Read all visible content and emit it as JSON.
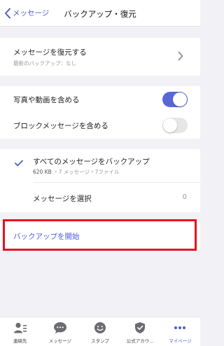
{
  "header": {
    "back_label": "メッセージ",
    "title": "バックアップ・復元"
  },
  "restore": {
    "title": "メッセージを復元する",
    "subtitle": "最新のバックアップ：なし"
  },
  "toggles": [
    {
      "label": "写真や動画を含める",
      "on": true
    },
    {
      "label": "ブロックメッセージを含める",
      "on": false
    }
  ],
  "backup_options": {
    "all": {
      "title": "すべてのメッセージをバックアップ",
      "size": "620 KB",
      "detail": "・7 メッセージ・7ファイル",
      "selected": true
    },
    "select": {
      "title": "メッセージを選択",
      "count": "0"
    }
  },
  "start_button": {
    "label": "バックアップを開始"
  },
  "tabbar": [
    {
      "label": "連絡先",
      "icon": "contacts-icon"
    },
    {
      "label": "メッセージ",
      "icon": "chat-bubble-icon"
    },
    {
      "label": "スタンプ",
      "icon": "smiley-icon"
    },
    {
      "label": "公式アカウ…",
      "icon": "verified-shield-icon"
    },
    {
      "label": "マイページ",
      "icon": "more-dots-icon",
      "active": true
    }
  ],
  "colors": {
    "accent": "#4a5cd6",
    "toggle_on": "#5966d9",
    "highlight": "#e8101e",
    "background": "#f2f2f6"
  }
}
